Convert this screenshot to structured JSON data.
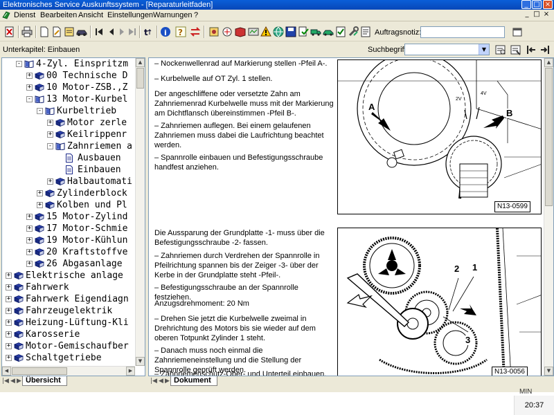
{
  "window": {
    "title": "Elektronisches Service Auskunftssystem - [Reparaturleitfaden]",
    "controls": {
      "minimize": "_",
      "maximize": "□",
      "close": "×"
    }
  },
  "menu": {
    "items": [
      "Dienst",
      "Bearbeiten",
      "Ansicht",
      "Einstellungen",
      "Warnungen",
      "?"
    ],
    "right_controls": [
      "_",
      "□",
      "×"
    ]
  },
  "toolbar": {
    "auftrag_label": "Auftragsnotiz:",
    "auftrag_value": ""
  },
  "subbar": {
    "unterkapitel": "Unterkapitel: Einbauen",
    "such_label": "Suchbegriff:",
    "such_value": ""
  },
  "tree": {
    "items": [
      {
        "label": "4-Zyl. Einspritzm",
        "state": "-",
        "icon": "book-open"
      },
      {
        "label": "00 Technische D",
        "state": "+",
        "icon": "book"
      },
      {
        "label": "10 Motor-ZSB.,Z",
        "state": "+",
        "icon": "book"
      },
      {
        "label": "13 Motor-Kurbel",
        "state": "-",
        "icon": "book-open"
      },
      {
        "label": "Kurbeltrieb",
        "state": "-",
        "icon": "book-open"
      },
      {
        "label": "Motor zerle",
        "state": "+",
        "icon": "book"
      },
      {
        "label": "Keilrippenr",
        "state": "+",
        "icon": "book"
      },
      {
        "label": "Zahnriemen a",
        "state": "-",
        "icon": "book-open"
      },
      {
        "label": "Ausbauen",
        "state": "",
        "icon": "doc"
      },
      {
        "label": "Einbauen",
        "state": "",
        "icon": "doc"
      },
      {
        "label": "Halbautomati",
        "state": "+",
        "icon": "book"
      },
      {
        "label": "Zylinderblock",
        "state": "+",
        "icon": "book"
      },
      {
        "label": "Kolben und Pl",
        "state": "+",
        "icon": "book"
      },
      {
        "label": "15 Motor-Zylind",
        "state": "+",
        "icon": "book"
      },
      {
        "label": "17 Motor-Schmie",
        "state": "+",
        "icon": "book"
      },
      {
        "label": "19 Motor-Kühlun",
        "state": "+",
        "icon": "book"
      },
      {
        "label": "20 Kraftstoffve",
        "state": "+",
        "icon": "book"
      },
      {
        "label": "26 Abgasanlage",
        "state": "+",
        "icon": "book"
      },
      {
        "label": "Elektrische anlage",
        "state": "+",
        "icon": "book"
      },
      {
        "label": "Fahrwerk",
        "state": "+",
        "icon": "book"
      },
      {
        "label": "Fahrwerk Eigendiagn",
        "state": "+",
        "icon": "book"
      },
      {
        "label": "Fahrzeugelektrik",
        "state": "+",
        "icon": "book"
      },
      {
        "label": "Heizung-Lüftung-Kli",
        "state": "+",
        "icon": "book"
      },
      {
        "label": "Karosserie",
        "state": "+",
        "icon": "book"
      },
      {
        "label": "Motor-Gemischaufber",
        "state": "+",
        "icon": "book"
      },
      {
        "label": "Schaltgetriebe",
        "state": "+",
        "icon": "book"
      }
    ]
  },
  "tabs": {
    "left": "Übersicht",
    "right": "Dokument"
  },
  "document": {
    "paragraphs": [
      "–   Nockenwellenrad auf Markierung stellen -Pfeil A-.",
      "–   Kurbelwelle auf OT Zyl. 1 stellen.",
      "Der angeschliffene oder versetzte Zahn am Zahnriemenrad Kurbelwelle muss mit der Markierung am Dichtflansch übereinstimmen -Pfeil B-.",
      "–   Zahnriemen auflegen. Bei einem gelaufenen Zahnriemen muss dabei die Laufrichtung beachtet werden.",
      "–   Spannrolle einbauen und Befestigungsschraube handfest anziehen.",
      "Die Aussparung der Grundplatte -1- muss über die Befestigungsschraube -2- fassen.",
      "–   Zahnriemen durch Verdrehen der Spannrolle in Pfeilrichtung spannen bis der Zeiger -3- über der Kerbe in der Grundplatte steht -Pfeil-.",
      "–   Befestigungsschraube an der Spannrolle festziehen.",
      "Anzugsdrehmoment: 20 Nm",
      "–   Drehen Sie jetzt die Kurbelwelle zweimal in Drehrichtung des Motors bis sie wieder auf dem oberen Totpunkt Zylinder 1 steht.",
      "–   Danach muss noch einmal die Zahnriemeneinstellung und die Stellung der Spannrolle geprüft werden.",
      "–   Zahnriemenschutz-Ober- und Unterteil einbauen."
    ],
    "figures": [
      {
        "id": "N13-0599",
        "labels": [
          "A",
          "B",
          "2V",
          "4V"
        ]
      },
      {
        "id": "N13-0056",
        "labels": [
          "2",
          "1",
          "3"
        ]
      }
    ]
  },
  "statusbar": {
    "mini": "MIN",
    "clock": "20:37"
  }
}
